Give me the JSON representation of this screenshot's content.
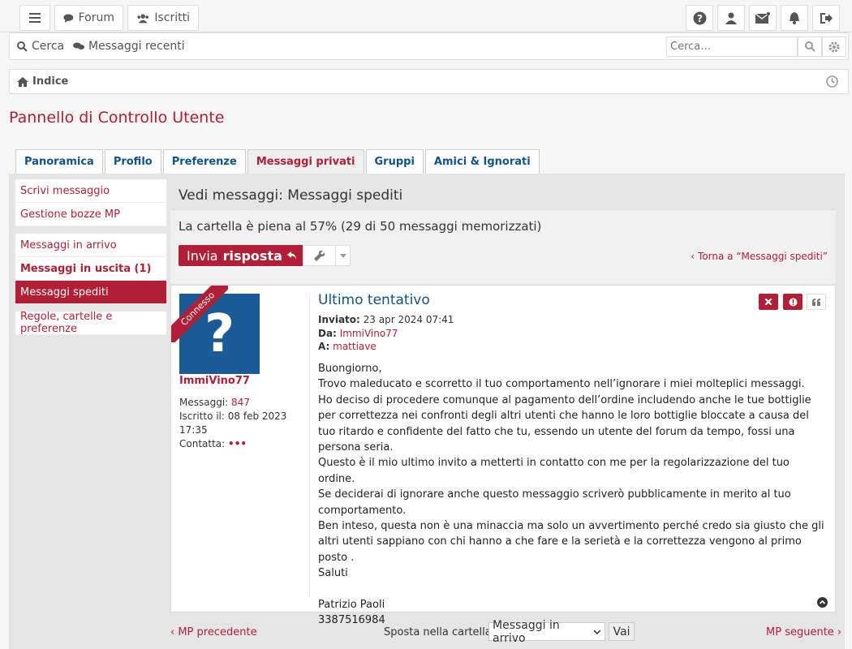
{
  "topbar": {
    "forum_label": "Forum",
    "members_label": "Iscritti"
  },
  "nav": {
    "search_label": "Cerca",
    "recent_label": "Messaggi recenti",
    "search_placeholder": "Cerca…"
  },
  "breadcrumb": {
    "home": "Indice"
  },
  "page_title": "Pannello di Controllo Utente",
  "tabs": [
    "Panoramica",
    "Profilo",
    "Preferenze",
    "Messaggi privati",
    "Gruppi",
    "Amici & Ignorati"
  ],
  "menu": {
    "group1": [
      "Scrivi messaggio",
      "Gestione bozze MP"
    ],
    "group2": [
      "Messaggi in arrivo",
      "Messaggi in uscita (1)",
      "Messaggi spediti"
    ],
    "group3": [
      "Regole, cartelle e preferenze"
    ]
  },
  "section_title": "Vedi messaggi: Messaggi spediti",
  "quota": "La cartella è piena al 57% (29 di 50 messaggi memorizzati)",
  "reply": {
    "prefix": "Invia",
    "bold": "risposta"
  },
  "back_link": "Torna a “Messaggi spediti”",
  "post": {
    "ribbon": "Connesso",
    "author": "ImmiVino77",
    "profile": {
      "posts_label": "Messaggi:",
      "posts_value": "847",
      "joined_label": "Iscritto il:",
      "joined_value": "08 feb 2023 17:35",
      "contact_label": "Contatta:",
      "contact_value": "•••"
    },
    "subject": "Ultimo tentativo",
    "sent_label": "Inviato:",
    "sent_value": "23 apr 2024 07:41",
    "from_label": "Da:",
    "from_value": "ImmiVino77",
    "to_label": "A:",
    "to_value": "mattiave",
    "body": [
      "Buongiorno,",
      "Trovo maleducato e scorretto il tuo comportamento nell’ignorare i miei molteplici messaggi.",
      "Ho deciso di procedere comunque al pagamento dell’ordine includendo anche le tue bottiglie per correttezza nei confronti degli altri utenti che hanno le loro bottiglie bloccate a causa del tuo ritardo e confidente del fatto che tu, essendo un utente del forum da tempo, fossi una persona seria.",
      "Questo è il mio ultimo invito a metterti in contatto con me per la regolarizzazione del tuo ordine.",
      "Se deciderai di ignorare anche questo messaggio scriverò pubblicamente in merito al tuo comportamento.",
      "Ben inteso, questa non è una minaccia ma solo un avvertimento perché credo sia giusto che gli altri utenti sappiano con chi hanno a che fare e la serietà e la correttezza vengono al primo posto .",
      "Saluti",
      "",
      "Patrizio Paoli",
      "3387516984"
    ]
  },
  "footer": {
    "prev": "MP precedente",
    "move_label": "Sposta nella cartella:",
    "folder_selected": "Messaggi in arrivo",
    "go": "Vai",
    "next": "MP seguente"
  }
}
